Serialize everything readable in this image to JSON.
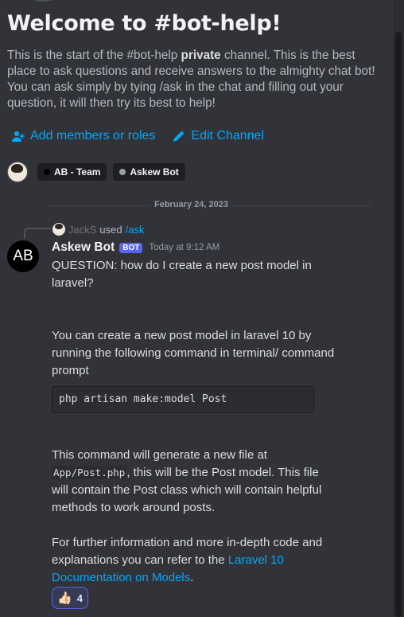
{
  "welcome": {
    "title": "Welcome to #bot-help!",
    "desc_pre": "This is the start of the #bot-help ",
    "desc_bold": "private",
    "desc_post": " channel. This is the best place to ask questions and receive answers to the almighty chat bot! You can ask simply by tying /ask in the chat and filling out your question, it will then try its best to help!"
  },
  "actions": {
    "add_members": "Add members or roles",
    "edit_channel": "Edit Channel"
  },
  "roles": [
    {
      "label": "AB - Team",
      "dot_color": "#000000"
    },
    {
      "label": "Askew Bot",
      "dot_color": "#9aa0a6"
    }
  ],
  "date_divider": "February 24, 2023",
  "reply": {
    "user": "JackS",
    "used": "used",
    "command": "/ask"
  },
  "message": {
    "avatar_text": "AB",
    "author": "Askew Bot",
    "bot_tag": "BOT",
    "timestamp": "Today at 9:12 AM",
    "question": "QUESTION: how do I create a new post model in laravel?",
    "answer_intro": "You can create a new post model in laravel 10 by running the following command in terminal/ command prompt",
    "code": "php artisan make:model Post",
    "file_pre": "This command will generate a new file at ",
    "file_code": "App/Post.php",
    "file_post": ", this will be the Post model. This file will contain the Post class which will contain helpful methods to work around posts.",
    "further_pre": "For further information and more in-depth code and explanations you can refer to the ",
    "further_link": "Laravel 10 Documentation on Models",
    "further_post": "."
  },
  "reaction": {
    "emoji": "👍🏻",
    "count": "4"
  },
  "colors": {
    "background": "#313338",
    "link": "#00a8fc",
    "bot_tag": "#5865f2"
  }
}
